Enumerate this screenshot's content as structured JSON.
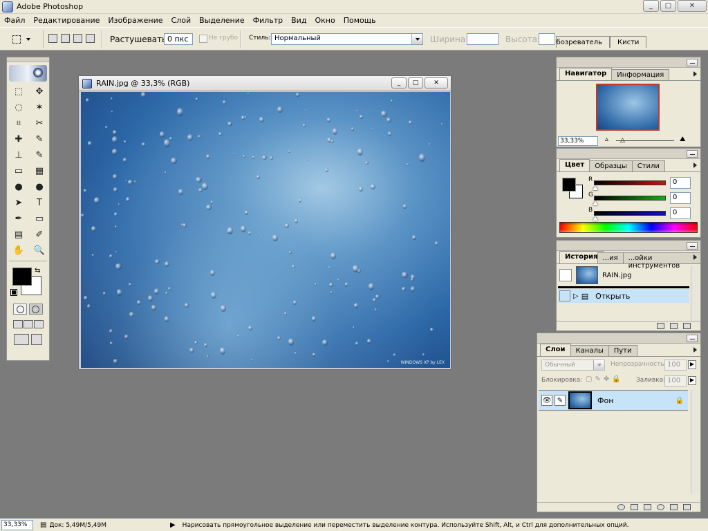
{
  "app": {
    "title": "Adobe Photoshop"
  },
  "window_controls": {
    "minimize": "_",
    "maximize": "□",
    "close": "✕"
  },
  "menu": [
    "Файл",
    "Редактирование",
    "Изображение",
    "Слой",
    "Выделение",
    "Фильтр",
    "Вид",
    "Окно",
    "Помощь"
  ],
  "options": {
    "feather_label": "Растушевать:",
    "feather_value": "0 пкс",
    "antialias_label": "Не грубо",
    "style_label": "Стиль:",
    "style_value": "Нормальный",
    "width_label": "Ширина",
    "height_label": "Высота:",
    "well_tabs": [
      "Обозреватель",
      "Кисти"
    ]
  },
  "document": {
    "title": "RAIN.jpg @ 33,3% (RGB)",
    "watermark": "WINDOWS XP by LEX"
  },
  "navigator": {
    "tabs": [
      "Навигатор",
      "Информация"
    ],
    "zoom": "33,33%"
  },
  "color": {
    "tabs": [
      "Цвет",
      "Образцы",
      "Стили"
    ],
    "channels": [
      {
        "label": "R",
        "value": "0",
        "color": "#d01010"
      },
      {
        "label": "G",
        "value": "0",
        "color": "#10b010"
      },
      {
        "label": "B",
        "value": "0",
        "color": "#1010c0"
      }
    ],
    "foreground": "#000000",
    "background": "#ffffff"
  },
  "history": {
    "tabs": [
      "История",
      "...ия",
      "...ойки инструментов"
    ],
    "snapshot": "RAIN.jpg",
    "states": [
      "Открыть"
    ]
  },
  "layers": {
    "tabs": [
      "Слои",
      "Каналы",
      "Пути"
    ],
    "blend_mode": "Обычный",
    "opacity_label": "Непрозрачность:",
    "opacity_value": "100",
    "lock_label": "Блокировка:",
    "fill_label": "Заливка:",
    "fill_value": "100",
    "items": [
      {
        "name": "Фон",
        "locked": true
      }
    ]
  },
  "status": {
    "zoom": "33,33%",
    "doc": "Док: 5,49M/5,49M",
    "hint": "Нарисовать прямоугольное выделение или переместить выделение контура. Используйте Shift, Alt, и Ctrl для дополнительных опций."
  },
  "tools": [
    "marquee-icon",
    "move-icon",
    "lasso-icon",
    "magic-wand-icon",
    "crop-icon",
    "slice-icon",
    "healing-brush-icon",
    "brush-icon",
    "clone-stamp-icon",
    "history-brush-icon",
    "eraser-icon",
    "gradient-icon",
    "blur-icon",
    "dodge-icon",
    "path-select-icon",
    "type-icon",
    "pen-icon",
    "shape-icon",
    "notes-icon",
    "eyedropper-icon",
    "hand-icon",
    "zoom-icon"
  ],
  "tool_glyphs": [
    "⬚",
    "✥",
    "◌",
    "✶",
    "⌗",
    "✂",
    "✚",
    "✎",
    "⊥",
    "✎",
    "▭",
    "▦",
    "●",
    "●",
    "➤",
    "T",
    "✒",
    "▭",
    "▤",
    "✐",
    "✋",
    "🔍"
  ]
}
